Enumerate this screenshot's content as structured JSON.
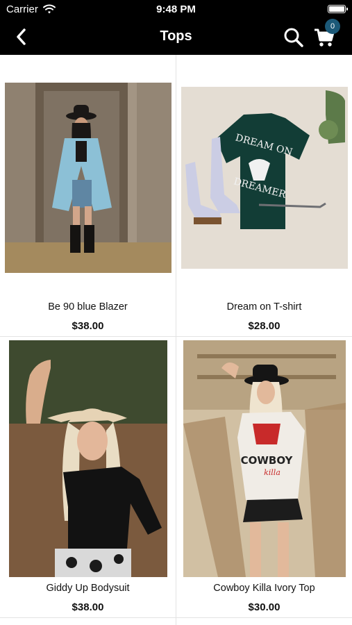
{
  "status_bar": {
    "carrier": "Carrier",
    "time": "9:48 PM"
  },
  "nav": {
    "title": "Tops",
    "cart_count": "0"
  },
  "products": [
    {
      "name": "Be 90 blue Blazer",
      "price": "$38.00"
    },
    {
      "name": "Dream on T-shirt",
      "price": "$28.00"
    },
    {
      "name": "Giddy Up Bodysuit",
      "price": "$38.00"
    },
    {
      "name": "Cowboy Killa Ivory Top",
      "price": "$30.00"
    }
  ],
  "images": {
    "p2_print_line1": "DREAM ON",
    "p2_print_line2": "DREAMER",
    "p4_print_line1": "COWBOY",
    "p4_print_line2": "killa"
  },
  "colors": {
    "bar": "#000000",
    "badge": "#1c5978",
    "background": "#ffffff"
  }
}
